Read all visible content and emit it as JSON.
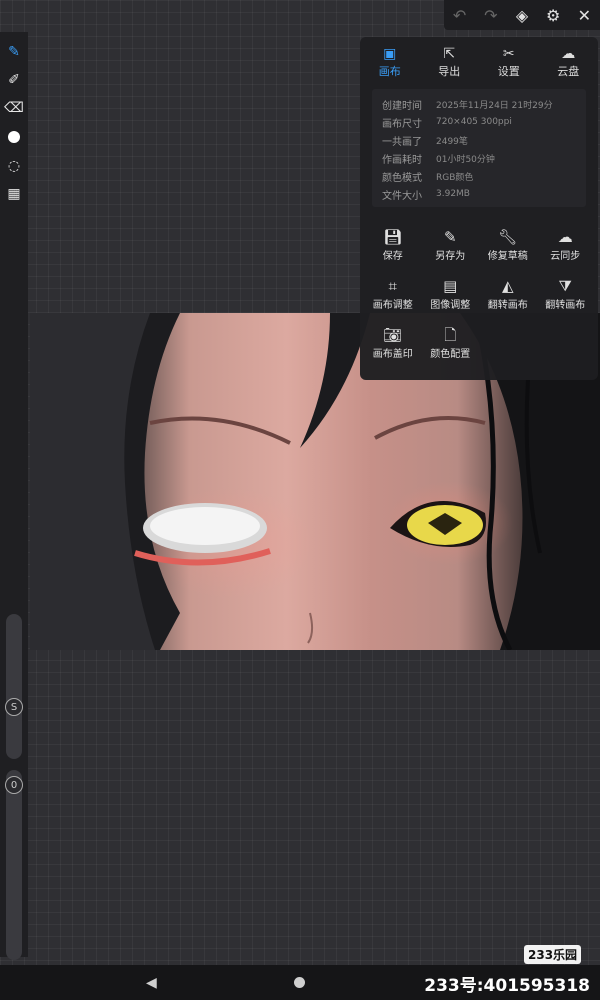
{
  "top_toolbar": {
    "undo_icon": "undo-icon",
    "redo_icon": "redo-icon",
    "layers_icon": "layers-icon",
    "settings_icon": "gear-icon",
    "close_icon": "close-icon"
  },
  "panel": {
    "tabs": [
      {
        "label": "画布",
        "icon": "canvas-icon",
        "active": true
      },
      {
        "label": "导出",
        "icon": "export-icon",
        "active": false
      },
      {
        "label": "设置",
        "icon": "settings-icon",
        "active": false
      },
      {
        "label": "云盘",
        "icon": "cloud-drive-icon",
        "active": false
      }
    ],
    "info": [
      {
        "key": "创建时间",
        "value": "2025年11月24日 21时29分"
      },
      {
        "key": "画布尺寸",
        "value": "720×405  300ppi"
      },
      {
        "key": "一共画了",
        "value": "2499笔"
      },
      {
        "key": "作画耗时",
        "value": "01小时50分钟"
      },
      {
        "key": "颜色模式",
        "value": "RGB颜色"
      },
      {
        "key": "文件大小",
        "value": "3.92MB"
      }
    ],
    "actions": [
      {
        "label": "保存",
        "icon": "save-icon"
      },
      {
        "label": "另存为",
        "icon": "save-as-icon"
      },
      {
        "label": "修复草稿",
        "icon": "wrench-icon"
      },
      {
        "label": "云同步",
        "icon": "cloud-sync-icon"
      },
      {
        "label": "画布调整",
        "icon": "crop-icon"
      },
      {
        "label": "图像调整",
        "icon": "image-adjust-icon"
      },
      {
        "label": "翻转画布",
        "icon": "flip-horizontal-icon"
      },
      {
        "label": "翻转画布",
        "icon": "flip-vertical-icon"
      },
      {
        "label": "画布盖印",
        "icon": "camera-icon"
      },
      {
        "label": "颜色配置",
        "icon": "color-config-icon"
      }
    ]
  },
  "left_toolbar": {
    "size_slider_label": "S",
    "opacity_slider_label": "0"
  },
  "watermark": {
    "badge": "233乐园",
    "id_text": "233号:401595318"
  }
}
